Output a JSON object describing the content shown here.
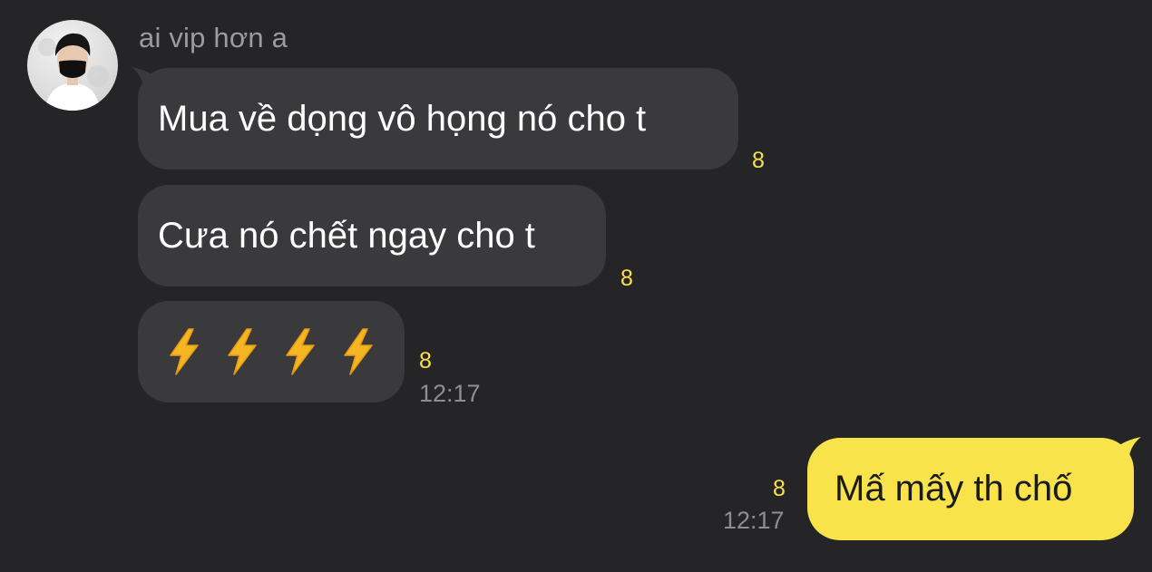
{
  "chat": {
    "sender_name": "ai vip hơn a",
    "incoming": [
      {
        "text": "Mua về dọng vô họng nó cho t",
        "unread": "8"
      },
      {
        "text": "Cưa nó chết ngay cho t",
        "unread": "8"
      },
      {
        "emoji": "⚡⚡⚡⚡",
        "emoji_icon": "lightning-bolt-icon",
        "unread": "8",
        "time": "12:17"
      }
    ],
    "outgoing": [
      {
        "text": "Mấ mấy th chố",
        "unread": "8",
        "time": "12:17"
      }
    ]
  },
  "colors": {
    "background": "#252527",
    "incoming_bubble": "#3a3a3c",
    "outgoing_bubble": "#f8e34a",
    "unread_count": "#f7e04d",
    "timestamp": "#8e8e90"
  }
}
